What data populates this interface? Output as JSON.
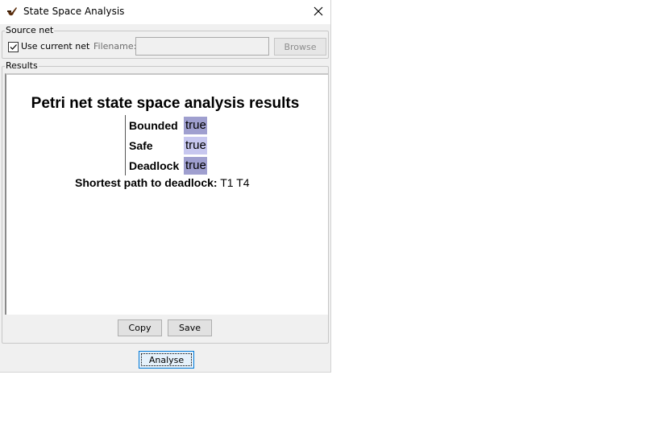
{
  "window": {
    "title": "State Space Analysis",
    "close_icon": "close-icon",
    "app_icon": "pipe-icon"
  },
  "source_net": {
    "legend": "Source net",
    "use_current_label": "Use current net",
    "use_current_checked": true,
    "filename_label": "Filename:",
    "filename_value": "",
    "browse_label": "Browse"
  },
  "results": {
    "legend": "Results",
    "heading": "Petri net state space analysis results",
    "rows": [
      {
        "label": "Bounded",
        "value": "true",
        "color": "#9f9fcf"
      },
      {
        "label": "Safe",
        "value": "true",
        "color": "#c7c7ef"
      },
      {
        "label": "Deadlock",
        "value": "true",
        "color": "#9f9fcf"
      }
    ],
    "shortest_path_label": "Shortest path to deadlock:",
    "shortest_path_value": "T1 T4",
    "copy_label": "Copy",
    "save_label": "Save"
  },
  "analyse_label": "Analyse"
}
